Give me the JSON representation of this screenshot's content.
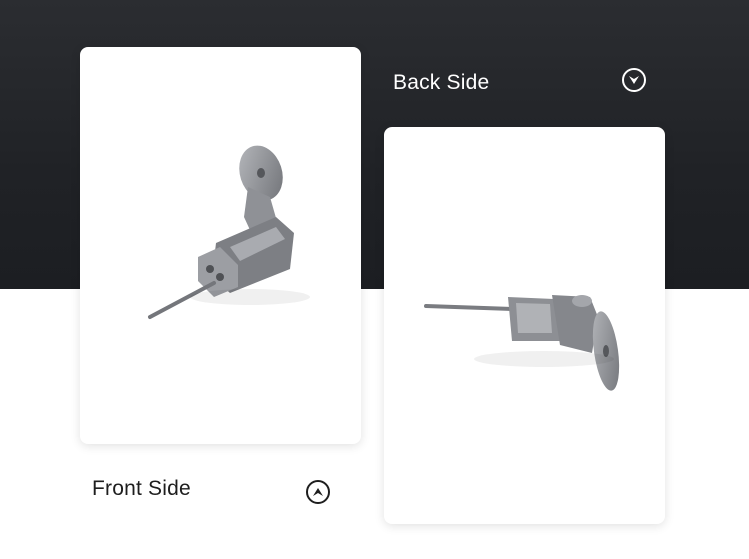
{
  "sections": {
    "back": {
      "label": "Back Side",
      "icon": "chevron-down-icon"
    },
    "front": {
      "label": "Front Side",
      "icon": "chevron-up-icon"
    }
  },
  "colors": {
    "dark_band": "#232529",
    "card": "#ffffff",
    "metal": "#8e9095",
    "text_dark": "#1e1e1e",
    "text_light": "#ffffff"
  }
}
